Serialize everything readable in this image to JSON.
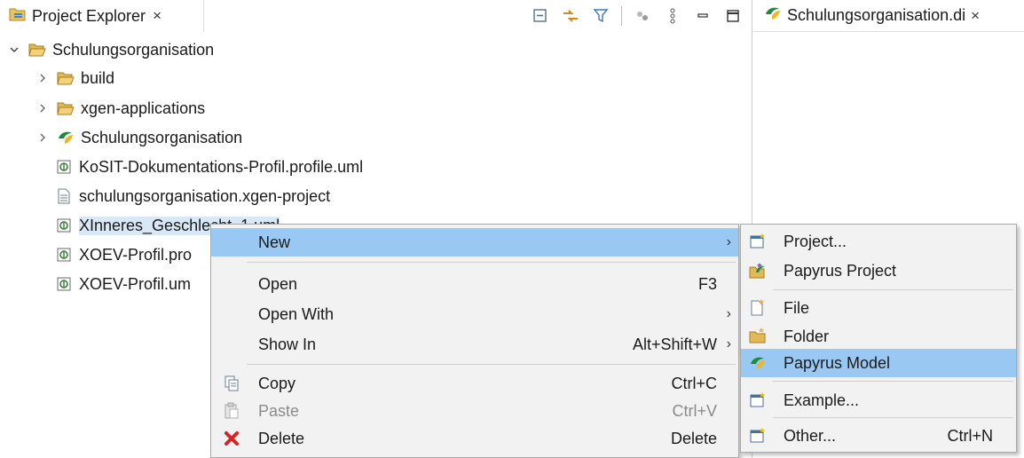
{
  "explorer": {
    "tab_title": "Project Explorer",
    "close_glyph": "×",
    "toolbar": [
      "collapse-all-icon",
      "link-with-editor-icon",
      "filter-icon",
      "toggle-icon",
      "view-menu-icon",
      "minimize-icon",
      "maximize-icon"
    ],
    "tree": [
      {
        "label": "Schulungsorganisation",
        "icon": "open-project-folder-icon",
        "twisty": "expanded"
      },
      {
        "label": "build",
        "icon": "folder-icon",
        "twisty": "collapsed"
      },
      {
        "label": "xgen-applications",
        "icon": "folder-icon",
        "twisty": "collapsed"
      },
      {
        "label": "Schulungsorganisation",
        "icon": "papyrus-model-icon",
        "twisty": "collapsed"
      },
      {
        "label": "KoSIT-Dokumentations-Profil.profile.uml",
        "icon": "uml-file-icon",
        "twisty": "none"
      },
      {
        "label": "schulungsorganisation.xgen-project",
        "icon": "text-file-icon",
        "twisty": "none"
      },
      {
        "label": "XInneres_Geschlecht_1.uml",
        "icon": "uml-file-icon",
        "twisty": "none"
      },
      {
        "label": "XOEV-Profil.pro",
        "icon": "uml-file-icon",
        "twisty": "none"
      },
      {
        "label": "XOEV-Profil.um",
        "icon": "uml-file-icon",
        "twisty": "none"
      }
    ]
  },
  "editor": {
    "tab_title": "Schulungsorganisation.di",
    "close_glyph": "×"
  },
  "context_menu": {
    "new": "New",
    "open": "Open",
    "open_accel": "F3",
    "open_with": "Open With",
    "show_in": "Show In",
    "show_in_accel": "Alt+Shift+W",
    "copy": "Copy",
    "copy_accel": "Ctrl+C",
    "paste": "Paste",
    "paste_accel": "Ctrl+V",
    "delete": "Delete",
    "delete_accel": "Delete",
    "arrow": "›"
  },
  "new_submenu": {
    "project": "Project...",
    "papyrus_project": "Papyrus Project",
    "file": "File",
    "folder": "Folder",
    "papyrus_model": "Papyrus Model",
    "example": "Example...",
    "other": "Other...",
    "other_accel": "Ctrl+N"
  },
  "colors": {
    "menu_highlight": "#99c9f2",
    "selection": "#d9e8f7",
    "menu_bg": "#f2f2f2"
  }
}
